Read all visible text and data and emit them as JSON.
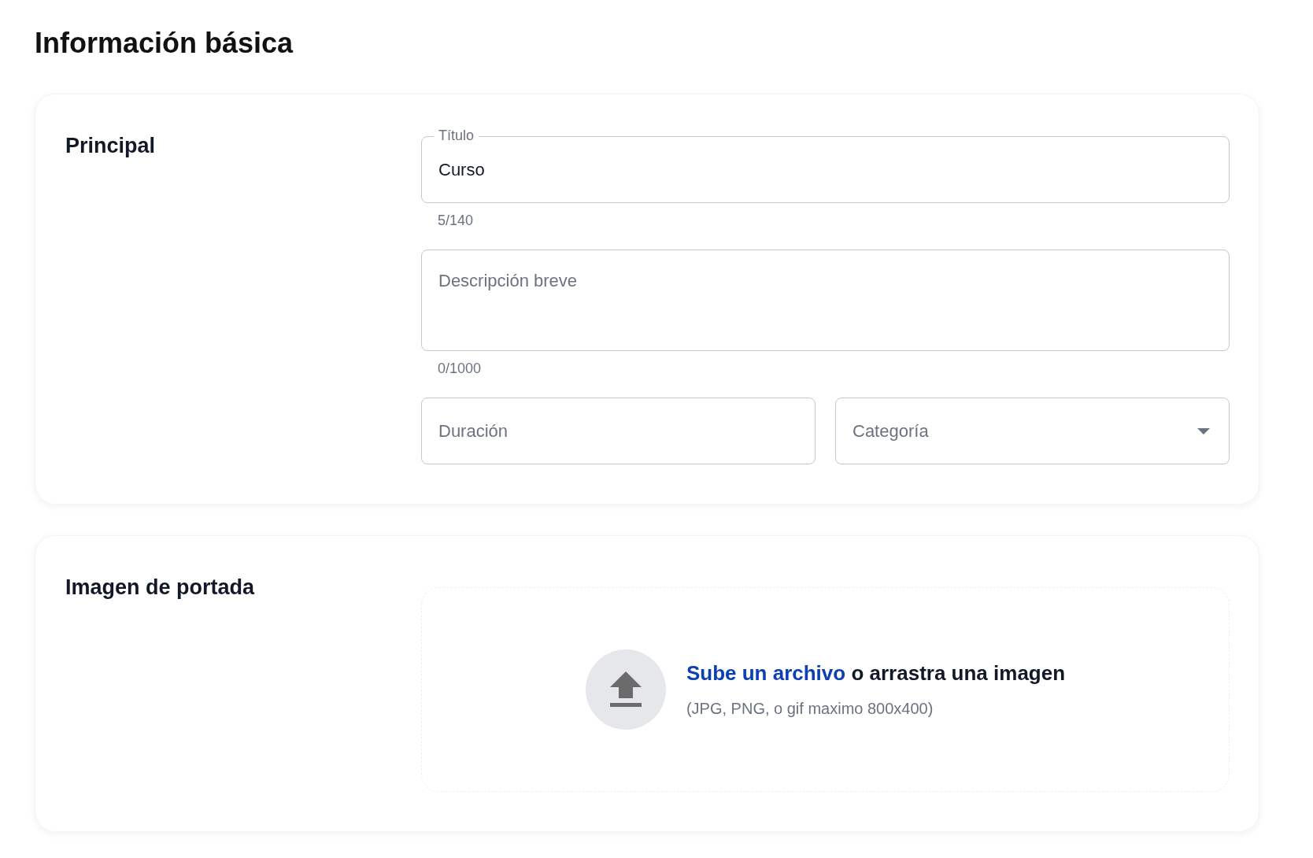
{
  "page_title": "Información básica",
  "sections": [
    {
      "kind": "fields",
      "heading": "Principal",
      "fields": [
        {
          "kind": "text",
          "label": "Título",
          "value": "Curso",
          "counter": "5/140"
        },
        {
          "kind": "textarea",
          "placeholder": "Descripción breve",
          "counter": "0/1000"
        }
      ],
      "row": [
        {
          "kind": "text",
          "placeholder": "Duración"
        },
        {
          "kind": "select",
          "placeholder": "Categoría"
        }
      ]
    },
    {
      "kind": "upload",
      "heading": "Imagen de portada",
      "link": "Sube un archivo",
      "text": "o arrastra una imagen",
      "hint": "(JPG, PNG, o gif maximo 800x400)"
    }
  ]
}
